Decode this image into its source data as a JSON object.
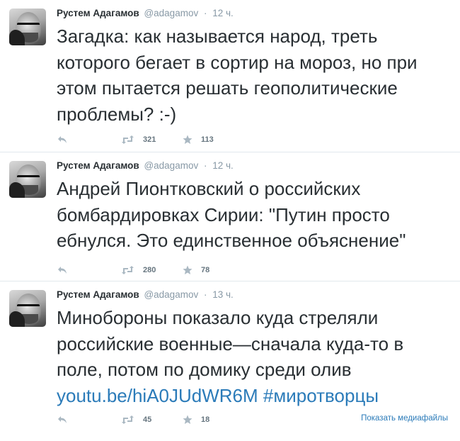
{
  "tweets": [
    {
      "author": "Рустем Адагамов",
      "handle": "@adagamov",
      "time": "12 ч.",
      "text": "Загадка: как называется народ, треть которого бегает в сортир на мороз, но при этом пытается решать геополитические проблемы? :-)",
      "retweets": "321",
      "favorites": "113"
    },
    {
      "author": "Рустем Адагамов",
      "handle": "@adagamov",
      "time": "12 ч.",
      "text": "Андрей Пионтковский о российских бомбардировках Сирии: \"Путин просто ебнулся. Это единственное объяснение\"",
      "retweets": "280",
      "favorites": "78"
    },
    {
      "author": "Рустем Адагамов",
      "handle": "@adagamov",
      "time": "13 ч.",
      "text": "Минобороны показало куда стреляли российские военные—сначала куда-то в поле, потом по домику среди олив",
      "link": "youtu.be/hiA0JUdWR6M",
      "hashtag": "#миротворцы",
      "retweets": "45",
      "favorites": "18",
      "media_label": "Показать медиафайлы"
    }
  ],
  "separator": "·",
  "icons": {
    "reply": "reply-icon",
    "retweet": "retweet-icon",
    "favorite": "star-icon"
  },
  "colors": {
    "link": "#2b7bb9",
    "muted": "#8899a6",
    "icon": "#aab8c2"
  }
}
